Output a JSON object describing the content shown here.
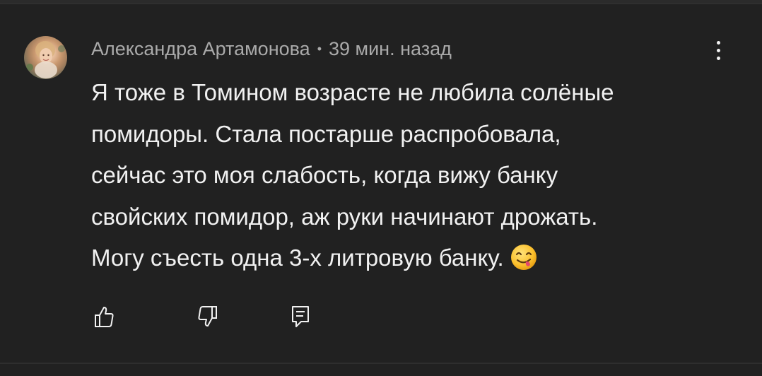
{
  "comment": {
    "author": "Александра Артамонова",
    "separator": "•",
    "time": "39 мин. назад",
    "text_lines": [
      "Я тоже в Томином возрасте не любила солёные",
      "помидоры. Стала постарше распробовала,",
      "сейчас это моя слабость, когда вижу банку",
      "свойских помидор, аж руки начинают дрожать.",
      "Могу съесть одна 3-х литровую банку."
    ],
    "emoji": "face-savoring-food-emoji",
    "avatar_icon": "user-avatar-photo"
  },
  "actions": {
    "like_icon": "thumbs-up-icon",
    "dislike_icon": "thumbs-down-icon",
    "reply_icon": "reply-comment-icon",
    "more_icon": "more-vertical-icon"
  },
  "colors": {
    "background": "#212121",
    "text_primary": "#f1f1f1",
    "text_secondary": "#aaaaaa"
  }
}
